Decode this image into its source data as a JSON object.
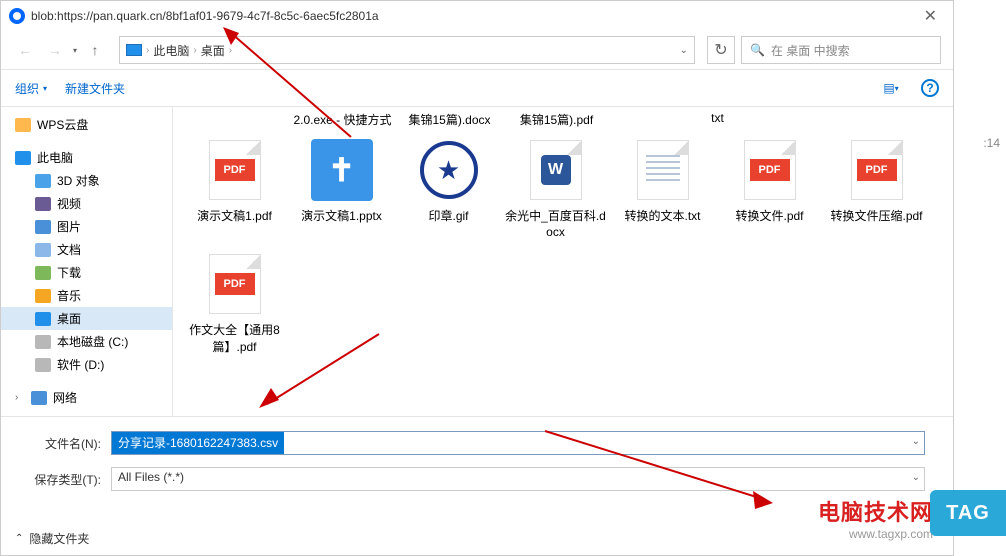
{
  "title": "blob:https://pan.quark.cn/8bf1af01-9679-4c7f-8c5c-6aec5fc2801a",
  "breadcrumb": {
    "root": "此电脑",
    "leaf": "桌面"
  },
  "search": {
    "placeholder": "在 桌面 中搜索"
  },
  "toolbar": {
    "organize": "组织",
    "new_folder": "新建文件夹"
  },
  "sidebar": {
    "wps": "WPS云盘",
    "pc": "此电脑",
    "children": [
      "3D 对象",
      "视频",
      "图片",
      "文档",
      "下载",
      "音乐",
      "桌面",
      "本地磁盘 (C:)",
      "软件 (D:)"
    ],
    "network": "网络"
  },
  "truncated_row": [
    "2.0.exe - 快捷方式",
    "集锦15篇).docx",
    "集锦15篇).pdf",
    "txt"
  ],
  "files": [
    {
      "name": "演示文稿1.pdf",
      "type": "pdf"
    },
    {
      "name": "演示文稿1.pptx",
      "type": "pptx"
    },
    {
      "name": "印章.gif",
      "type": "stamp"
    },
    {
      "name": "余光中_百度百科.docx",
      "type": "docx"
    },
    {
      "name": "转换的文本.txt",
      "type": "txt"
    },
    {
      "name": "转换文件.pdf",
      "type": "pdf"
    },
    {
      "name": "转换文件压缩.pdf",
      "type": "pdf"
    },
    {
      "name": "作文大全【通用8篇】.pdf",
      "type": "pdf"
    }
  ],
  "form": {
    "filename_label": "文件名(N):",
    "filename_value": "分享记录-1680162247383.csv",
    "type_label": "保存类型(T):",
    "type_value": "All Files (*.*)"
  },
  "footer": {
    "hide_folders": "隐藏文件夹"
  },
  "watermark": {
    "text": "电脑技术网",
    "url": "www.tagxp.com",
    "tag": "TAG"
  },
  "side_time": ":14"
}
